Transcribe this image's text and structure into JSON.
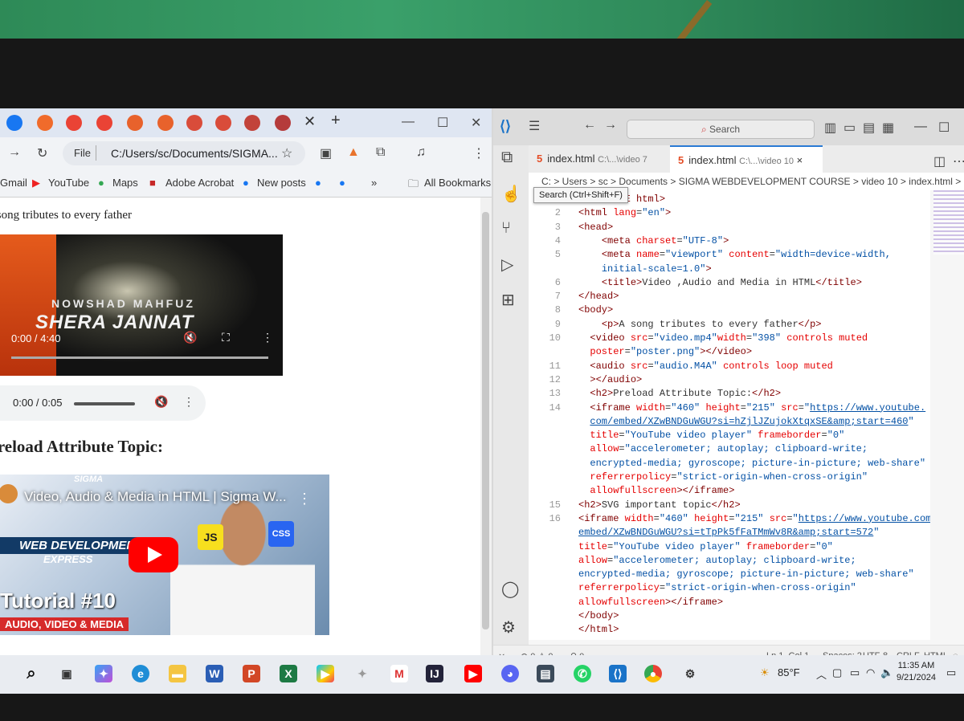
{
  "chrome": {
    "url_chip": "File",
    "url": "C:/Users/sc/Documents/SIGMA...",
    "bookmarks": [
      "Gmail",
      "YouTube",
      "Maps",
      "Adobe Acrobat",
      "New posts",
      "»",
      "All Bookmarks"
    ],
    "page": {
      "paragraph": "A song tributes to every father",
      "video": {
        "artist": "NOWSHAD MAHFUZ",
        "song": "SHERA JANNAT",
        "time": "0:00 / 4:40"
      },
      "audio": {
        "time": "0:00 / 0:05"
      },
      "heading": "Preload Attribute Topic:",
      "youtube": {
        "title": "Video, Audio & Media in HTML | Sigma W...",
        "brand": "SIGMA",
        "webdev": "WEB DEVELOPMENT",
        "express": "EXPRESS",
        "tutorial": "Tutorial #10",
        "subtitle": "AUDIO, VIDEO & MEDIA",
        "badges": [
          "JS",
          "CSS"
        ]
      }
    }
  },
  "vscode": {
    "search_placeholder": "Search",
    "tooltip": "Search (Ctrl+Shift+F)",
    "tabs": [
      {
        "name": "index.html",
        "path": "C:\\...\\video 7"
      },
      {
        "name": "index.html",
        "path": "C:\\...\\video 10",
        "close": "×"
      }
    ],
    "breadcrumbs": "C: > Users > sc > Documents > SIGMA WEBDEVELOPMENT COURSE > video 10 > index.html > ...",
    "code_lines": [
      {
        "n": "",
        "html": "<span class=\"tg\">&lt;!DOCTYPE html&gt;</span>"
      },
      {
        "n": "2",
        "html": "<span class=\"tg\">&lt;html</span> <span class=\"at\">lang</span>=<span class=\"st\">\"en\"</span><span class=\"tg\">&gt;</span>"
      },
      {
        "n": "3",
        "html": "<span class=\"tg\">&lt;head&gt;</span>"
      },
      {
        "n": "4",
        "html": "&nbsp;&nbsp;&nbsp;&nbsp;<span class=\"tg\">&lt;meta</span> <span class=\"at\">charset</span>=<span class=\"st\">\"UTF-8\"</span><span class=\"tg\">&gt;</span>"
      },
      {
        "n": "5",
        "html": "&nbsp;&nbsp;&nbsp;&nbsp;<span class=\"tg\">&lt;meta</span> <span class=\"at\">name</span>=<span class=\"st\">\"viewport\"</span> <span class=\"at\">content</span>=<span class=\"st\">\"width=device-width,</span>"
      },
      {
        "n": "",
        "html": "&nbsp;&nbsp;&nbsp;&nbsp;<span class=\"st\">initial-scale=1.0\"</span><span class=\"tg\">&gt;</span>"
      },
      {
        "n": "6",
        "html": "&nbsp;&nbsp;&nbsp;&nbsp;<span class=\"tg\">&lt;title&gt;</span>Video ,Audio and Media in HTML<span class=\"tg\">&lt;/title&gt;</span>"
      },
      {
        "n": "7",
        "html": "<span class=\"tg\">&lt;/head&gt;</span>"
      },
      {
        "n": "8",
        "html": "<span class=\"tg\">&lt;body&gt;</span>"
      },
      {
        "n": "9",
        "html": "&nbsp;&nbsp;&nbsp;&nbsp;<span class=\"tg\">&lt;p&gt;</span>A song tributes to every father<span class=\"tg\">&lt;/p&gt;</span>"
      },
      {
        "n": "10",
        "html": "&nbsp;&nbsp;<span class=\"tg\">&lt;video</span> <span class=\"at\">src</span>=<span class=\"st\">\"video.mp4\"</span><span class=\"at\">width</span>=<span class=\"st\">\"398\"</span> <span class=\"at\">controls muted</span>"
      },
      {
        "n": "",
        "html": "&nbsp;&nbsp;<span class=\"at\">poster</span>=<span class=\"st\">\"poster.png\"</span><span class=\"tg\">&gt;&lt;/video&gt;</span>"
      },
      {
        "n": "11",
        "html": "&nbsp;&nbsp;<span class=\"tg\">&lt;audio</span> <span class=\"at\">src</span>=<span class=\"st\">\"audio.M4A\"</span> <span class=\"at\">controls loop muted</span>"
      },
      {
        "n": "12",
        "html": "&nbsp;&nbsp;<span class=\"tg\">&gt;&lt;/audio&gt;</span>"
      },
      {
        "n": "13",
        "html": "&nbsp;&nbsp;<span class=\"tg\">&lt;h2&gt;</span>Preload Attribute Topic:<span class=\"tg\">&lt;/h2&gt;</span>"
      },
      {
        "n": "14",
        "html": "&nbsp;&nbsp;<span class=\"tg\">&lt;iframe</span> <span class=\"at\">width</span>=<span class=\"st\">\"460\"</span> <span class=\"at\">height</span>=<span class=\"st\">\"215\"</span> <span class=\"at\">src</span>=<span class=\"st\">\"</span><span class=\"ur\">https://www.youtube.</span>"
      },
      {
        "n": "",
        "html": "&nbsp;&nbsp;<span class=\"ur\">com/embed/XZwBNDGuWGU?si=hZjlJZujokXtqxSE&amp;amp;start=460</span><span class=\"st\">\"</span>"
      },
      {
        "n": "",
        "html": "&nbsp;&nbsp;<span class=\"at\">title</span>=<span class=\"st\">\"YouTube video player\"</span> <span class=\"at\">frameborder</span>=<span class=\"st\">\"0\"</span>"
      },
      {
        "n": "",
        "html": "&nbsp;&nbsp;<span class=\"at\">allow</span>=<span class=\"st\">\"accelerometer; autoplay; clipboard-write;</span>"
      },
      {
        "n": "",
        "html": "&nbsp;&nbsp;<span class=\"st\">encrypted-media; gyroscope; picture-in-picture; web-share\"</span>"
      },
      {
        "n": "",
        "html": "&nbsp;&nbsp;<span class=\"at\">referrerpolicy</span>=<span class=\"st\">\"strict-origin-when-cross-origin\"</span>"
      },
      {
        "n": "",
        "html": "&nbsp;&nbsp;<span class=\"at\">allowfullscreen</span><span class=\"tg\">&gt;&lt;/iframe&gt;</span>"
      },
      {
        "n": "15",
        "html": "<span class=\"tg\">&lt;h2&gt;</span>SVG important topic<span class=\"tg\">&lt;/h2&gt;</span>"
      },
      {
        "n": "16",
        "html": "<span class=\"tg\">&lt;iframe</span> <span class=\"at\">width</span>=<span class=\"st\">\"460\"</span> <span class=\"at\">height</span>=<span class=\"st\">\"215\"</span> <span class=\"at\">src</span>=<span class=\"st\">\"</span><span class=\"ur\">https://www.youtube.com/</span>"
      },
      {
        "n": "",
        "html": "<span class=\"ur\">embed/XZwBNDGuWGU?si=tTpPk5fFaTMmWv8R&amp;amp;start=572</span><span class=\"st\">\"</span>"
      },
      {
        "n": "",
        "html": "<span class=\"at\">title</span>=<span class=\"st\">\"YouTube video player\"</span> <span class=\"at\">frameborder</span>=<span class=\"st\">\"0\"</span>"
      },
      {
        "n": "",
        "html": "<span class=\"at\">allow</span>=<span class=\"st\">\"accelerometer; autoplay; clipboard-write;</span>"
      },
      {
        "n": "",
        "html": "<span class=\"st\">encrypted-media; gyroscope; picture-in-picture; web-share\"</span>"
      },
      {
        "n": "",
        "html": "<span class=\"at\">referrerpolicy</span>=<span class=\"st\">\"strict-origin-when-cross-origin\"</span>"
      },
      {
        "n": "",
        "html": "<span class=\"at\">allowfullscreen</span><span class=\"tg\">&gt;&lt;/iframe&gt;</span>"
      },
      {
        "n": "",
        "html": "<span class=\"tg\">&lt;/body&gt;</span>"
      },
      {
        "n": "",
        "html": "<span class=\"tg\">&lt;/html&gt;</span>"
      }
    ],
    "status": {
      "problems": "⊗ 0 ⚠ 0",
      "ports": "⚲ 0",
      "position": "Ln 1, Col 1",
      "spaces": "Spaces: 2",
      "encoding": "UTF-8",
      "eol": "CRLF",
      "language": "HTML"
    }
  },
  "taskbar": {
    "temperature": "85°F",
    "time": "11:35 AM",
    "date": "9/21/2024"
  },
  "colors": {
    "vscode_blue": "#2a7ad4",
    "html_tag": "#800000",
    "html_attr": "#e50000",
    "html_string": "#0451a5",
    "youtube_red": "#ff0000"
  }
}
